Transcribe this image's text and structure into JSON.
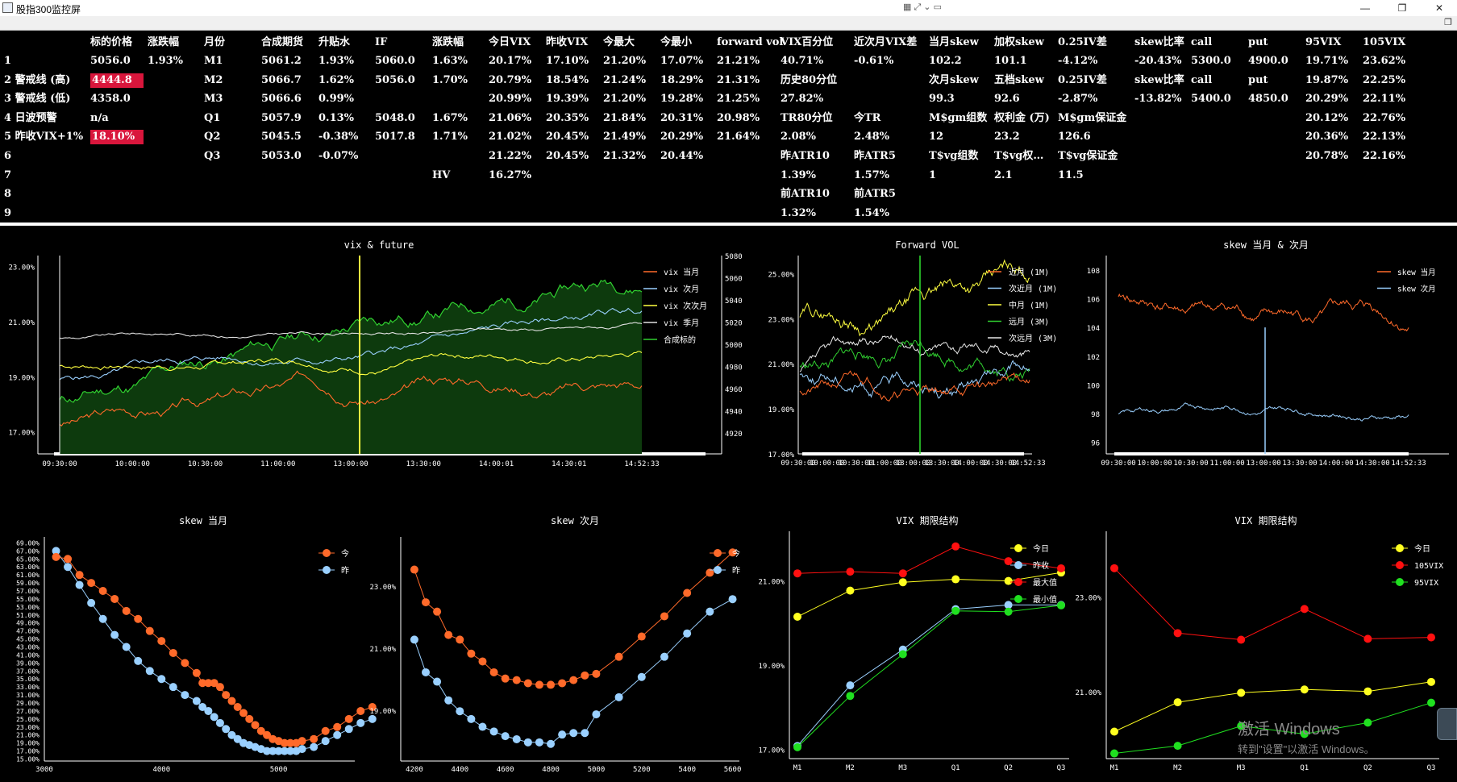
{
  "window": {
    "title": "股指300监控屏",
    "min": "—",
    "max": "❐",
    "close": "✕"
  },
  "table": {
    "headers": [
      [
        "标的价格",
        112
      ],
      [
        "涨跌幅",
        183
      ],
      [
        "月份",
        253
      ],
      [
        "合成期货",
        324
      ],
      [
        "升贴水",
        395
      ],
      [
        "IF",
        465
      ],
      [
        "涨跌幅",
        536
      ],
      [
        "今日VIX",
        606
      ],
      [
        "昨收VIX",
        677
      ],
      [
        "今最大",
        748
      ],
      [
        "今最小",
        819
      ],
      [
        "forward vol",
        889
      ],
      [
        "VIX百分位",
        968
      ],
      [
        "近次月VIX差",
        1059
      ],
      [
        "当月skew",
        1152
      ],
      [
        "加权skew",
        1233
      ],
      [
        "0.25IV差",
        1312
      ],
      [
        "skew比率",
        1407
      ],
      [
        "call",
        1477
      ],
      [
        "put",
        1548
      ],
      [
        "95VIX",
        1619
      ],
      [
        "105VIX",
        1690
      ]
    ],
    "rows": [
      [
        [
          "1",
          5
        ],
        [
          "5056.0",
          112
        ],
        [
          "1.93%",
          183
        ],
        [
          "M1",
          253
        ],
        [
          "5061.2",
          324
        ],
        [
          "1.93%",
          395
        ],
        [
          "5060.0",
          465
        ],
        [
          "1.63%",
          536
        ],
        [
          "20.17%",
          606
        ],
        [
          "17.10%",
          677
        ],
        [
          "21.20%",
          748
        ],
        [
          "17.07%",
          819
        ],
        [
          "21.21%",
          889
        ],
        [
          "40.71%",
          968
        ],
        [
          "-0.61%",
          1059
        ],
        [
          "102.2",
          1152
        ],
        [
          "101.1",
          1233
        ],
        [
          "-4.12%",
          1312
        ],
        [
          "-20.43%",
          1407
        ],
        [
          "5300.0",
          1477
        ],
        [
          "4900.0",
          1548
        ],
        [
          "19.71%",
          1619
        ],
        [
          "23.62%",
          1690
        ]
      ],
      [
        [
          "2 警戒线 (高)",
          5
        ],
        [
          "4444.8",
          112,
          "red"
        ],
        [
          "M2",
          253
        ],
        [
          "5066.7",
          324
        ],
        [
          "1.62%",
          395
        ],
        [
          "5056.0",
          465
        ],
        [
          "1.70%",
          536
        ],
        [
          "20.79%",
          606
        ],
        [
          "18.54%",
          677
        ],
        [
          "21.24%",
          748
        ],
        [
          "18.29%",
          819
        ],
        [
          "21.31%",
          889
        ],
        [
          "历史80分位",
          968
        ],
        [
          "次月skew",
          1152
        ],
        [
          "五档skew",
          1233
        ],
        [
          "0.25IV差",
          1312
        ],
        [
          "skew比率",
          1407
        ],
        [
          "call",
          1477
        ],
        [
          "put",
          1548
        ],
        [
          "19.87%",
          1619
        ],
        [
          "22.25%",
          1690
        ]
      ],
      [
        [
          "3 警戒线 (低)",
          5
        ],
        [
          "4358.0",
          112
        ],
        [
          "M3",
          253
        ],
        [
          "5066.6",
          324
        ],
        [
          "0.99%",
          395
        ],
        [
          "20.99%",
          606
        ],
        [
          "19.39%",
          677
        ],
        [
          "21.20%",
          748
        ],
        [
          "19.28%",
          819
        ],
        [
          "21.25%",
          889
        ],
        [
          "27.82%",
          968
        ],
        [
          "99.3",
          1152
        ],
        [
          "92.6",
          1233
        ],
        [
          "-2.87%",
          1312
        ],
        [
          "-13.82%",
          1407
        ],
        [
          "5400.0",
          1477
        ],
        [
          "4850.0",
          1548
        ],
        [
          "20.29%",
          1619
        ],
        [
          "22.11%",
          1690
        ]
      ],
      [
        [
          "4 日波预警",
          5
        ],
        [
          "n/a",
          112
        ],
        [
          "Q1",
          253
        ],
        [
          "5057.9",
          324
        ],
        [
          "0.13%",
          395
        ],
        [
          "5048.0",
          465
        ],
        [
          "1.67%",
          536
        ],
        [
          "21.06%",
          606
        ],
        [
          "20.35%",
          677
        ],
        [
          "21.84%",
          748
        ],
        [
          "20.31%",
          819
        ],
        [
          "20.98%",
          889
        ],
        [
          "TR80分位",
          968
        ],
        [
          "今TR",
          1059
        ],
        [
          "M$gm组数",
          1152
        ],
        [
          "权利金 (万)",
          1233
        ],
        [
          "M$gm保证金",
          1312
        ],
        [
          "20.12%",
          1619
        ],
        [
          "22.76%",
          1690
        ]
      ],
      [
        [
          "5 昨收VIX+1%",
          5
        ],
        [
          "18.10%",
          112,
          "red"
        ],
        [
          "Q2",
          253
        ],
        [
          "5045.5",
          324
        ],
        [
          "-0.38%",
          395
        ],
        [
          "5017.8",
          465
        ],
        [
          "1.71%",
          536
        ],
        [
          "21.02%",
          606
        ],
        [
          "20.45%",
          677
        ],
        [
          "21.49%",
          748
        ],
        [
          "20.29%",
          819
        ],
        [
          "21.64%",
          889
        ],
        [
          "2.08%",
          968
        ],
        [
          "2.48%",
          1059
        ],
        [
          "12",
          1152
        ],
        [
          "23.2",
          1233
        ],
        [
          "126.6",
          1312
        ],
        [
          "20.36%",
          1619
        ],
        [
          "22.13%",
          1690
        ]
      ],
      [
        [
          "6",
          5
        ],
        [
          "Q3",
          253
        ],
        [
          "5053.0",
          324
        ],
        [
          "-0.07%",
          395
        ],
        [
          "21.22%",
          606
        ],
        [
          "20.45%",
          677
        ],
        [
          "21.32%",
          748
        ],
        [
          "20.44%",
          819
        ],
        [
          "昨ATR10",
          968
        ],
        [
          "昨ATR5",
          1059
        ],
        [
          "T$vg组数",
          1152
        ],
        [
          "T$vg权…",
          1233
        ],
        [
          "T$vg保证金",
          1312
        ],
        [
          "20.78%",
          1619
        ],
        [
          "22.16%",
          1690
        ]
      ],
      [
        [
          "7",
          5
        ],
        [
          "HV",
          536
        ],
        [
          "16.27%",
          606
        ],
        [
          "1.39%",
          968
        ],
        [
          "1.57%",
          1059
        ],
        [
          "1",
          1152
        ],
        [
          "2.1",
          1233
        ],
        [
          "11.5",
          1312
        ]
      ],
      [
        [
          "8",
          5
        ],
        [
          "前ATR10",
          968
        ],
        [
          "前ATR5",
          1059
        ]
      ],
      [
        [
          "9",
          5
        ],
        [
          "1.32%",
          968
        ],
        [
          "1.54%",
          1059
        ]
      ]
    ]
  },
  "charts": {
    "vix_future": {
      "title": "vix & future",
      "yleft": [
        "23.00%",
        "21.00%",
        "19.00%",
        "17.00%"
      ],
      "yright": [
        "5080",
        "5060",
        "5040",
        "5020",
        "5000",
        "4980",
        "4960",
        "4940",
        "4920"
      ],
      "xlabels": [
        "09:30:00",
        "10:00:00",
        "10:30:00",
        "11:00:00",
        "13:00:00",
        "13:30:00",
        "14:00:01",
        "14:30:01",
        "14:52:33"
      ],
      "legend": [
        "vix 当月",
        "vix 次月",
        "vix 次次月",
        "vix 季月",
        "合成标的"
      ],
      "colors": [
        "#ff6a2a",
        "#9ad0ff",
        "#ffff40",
        "#e0e0e0",
        "#30d030"
      ]
    },
    "forward_vol": {
      "title": "Forward VOL",
      "ylabels": [
        "25.00%",
        "23.00%",
        "21.00%",
        "19.00%",
        "17.00%"
      ],
      "xlabels": [
        "09:30:00",
        "10:00:00",
        "10:30:00",
        "11:00:00",
        "13:00:00",
        "13:30:00",
        "14:00:00",
        "14:30:00",
        "14:52:33"
      ],
      "legend": [
        "近月 (1M)",
        "次近月 (1M)",
        "中月 (1M)",
        "远月 (3M)",
        "次远月 (3M)"
      ],
      "colors": [
        "#ff6a2a",
        "#9ad0ff",
        "#ffff40",
        "#30d030",
        "#e8e8e8"
      ]
    },
    "skew_both": {
      "title": "skew 当月 & 次月",
      "ylabels": [
        "108",
        "106",
        "104",
        "102",
        "100",
        "98",
        "96"
      ],
      "xlabels": [
        "09:30:00",
        "10:00:00",
        "10:30:00",
        "11:00:00",
        "13:00:00",
        "13:30:00",
        "14:00:00",
        "14:30:00",
        "14:52:33"
      ],
      "legend": [
        "skew 当月",
        "skew 次月"
      ],
      "colors": [
        "#ff6a2a",
        "#9ad0ff"
      ]
    },
    "skew_m1": {
      "title": "skew 当月",
      "legend": [
        "今",
        "昨"
      ],
      "xlabels": [
        "3000",
        "4000",
        "5000"
      ],
      "ylabels": [
        "69.00%",
        "67.00%",
        "65.00%",
        "63.00%",
        "61.00%",
        "59.00%",
        "57.00%",
        "55.00%",
        "53.00%",
        "51.00%",
        "49.00%",
        "47.00%",
        "45.00%",
        "43.00%",
        "41.00%",
        "39.00%",
        "37.00%",
        "35.00%",
        "33.00%",
        "31.00%",
        "29.00%",
        "27.00%",
        "25.00%",
        "23.00%",
        "21.00%",
        "19.00%",
        "17.00%",
        "15.00%"
      ],
      "today": [
        [
          3100,
          65.5
        ],
        [
          3200,
          65
        ],
        [
          3300,
          61
        ],
        [
          3400,
          59
        ],
        [
          3500,
          57
        ],
        [
          3600,
          55
        ],
        [
          3700,
          52
        ],
        [
          3800,
          50
        ],
        [
          3900,
          47
        ],
        [
          4000,
          44.5
        ],
        [
          4100,
          41.5
        ],
        [
          4200,
          39
        ],
        [
          4300,
          36.5
        ],
        [
          4350,
          34
        ],
        [
          4400,
          34
        ],
        [
          4450,
          34
        ],
        [
          4500,
          33
        ],
        [
          4550,
          31
        ],
        [
          4600,
          29.5
        ],
        [
          4650,
          28
        ],
        [
          4700,
          26.5
        ],
        [
          4750,
          25
        ],
        [
          4800,
          23.5
        ],
        [
          4850,
          22
        ],
        [
          4900,
          21
        ],
        [
          4950,
          20
        ],
        [
          5000,
          19.5
        ],
        [
          5050,
          19
        ],
        [
          5100,
          19
        ],
        [
          5150,
          19
        ],
        [
          5200,
          19.5
        ],
        [
          5300,
          20
        ],
        [
          5400,
          22
        ],
        [
          5500,
          23
        ],
        [
          5600,
          25
        ],
        [
          5700,
          27
        ],
        [
          5800,
          28
        ]
      ],
      "yest": [
        [
          3100,
          67
        ],
        [
          3200,
          63
        ],
        [
          3300,
          58.5
        ],
        [
          3400,
          54
        ],
        [
          3500,
          50
        ],
        [
          3600,
          46
        ],
        [
          3700,
          43
        ],
        [
          3800,
          39.5
        ],
        [
          3900,
          37
        ],
        [
          4000,
          35
        ],
        [
          4100,
          33
        ],
        [
          4200,
          31
        ],
        [
          4300,
          29.5
        ],
        [
          4350,
          28
        ],
        [
          4400,
          27
        ],
        [
          4450,
          25.5
        ],
        [
          4500,
          24
        ],
        [
          4550,
          22.5
        ],
        [
          4600,
          21
        ],
        [
          4650,
          20
        ],
        [
          4700,
          19
        ],
        [
          4750,
          18.5
        ],
        [
          4800,
          18
        ],
        [
          4850,
          17.5
        ],
        [
          4900,
          17
        ],
        [
          4950,
          17
        ],
        [
          5000,
          17
        ],
        [
          5050,
          17
        ],
        [
          5100,
          17
        ],
        [
          5150,
          17
        ],
        [
          5200,
          17.5
        ],
        [
          5300,
          18
        ],
        [
          5400,
          19.5
        ],
        [
          5500,
          21
        ],
        [
          5600,
          22.5
        ],
        [
          5700,
          24
        ],
        [
          5800,
          25
        ]
      ]
    },
    "skew_m2": {
      "title": "skew 次月",
      "legend": [
        "今",
        "昨"
      ],
      "xlabels": [
        "4200",
        "4400",
        "4600",
        "4800",
        "5000",
        "5200",
        "5400",
        "5600"
      ],
      "ylabels": [
        "23.00%",
        "21.00%",
        "19.00%"
      ],
      "today": [
        [
          4200,
          23.55
        ],
        [
          4250,
          22.5
        ],
        [
          4300,
          22.2
        ],
        [
          4350,
          21.45
        ],
        [
          4400,
          21.3
        ],
        [
          4450,
          20.85
        ],
        [
          4500,
          20.6
        ],
        [
          4550,
          20.25
        ],
        [
          4600,
          20.05
        ],
        [
          4650,
          20.0
        ],
        [
          4700,
          19.9
        ],
        [
          4750,
          19.85
        ],
        [
          4800,
          19.85
        ],
        [
          4850,
          19.9
        ],
        [
          4900,
          20.0
        ],
        [
          4950,
          20.15
        ],
        [
          5000,
          20.2
        ],
        [
          5100,
          20.75
        ],
        [
          5200,
          21.4
        ],
        [
          5300,
          22.05
        ],
        [
          5400,
          22.8
        ],
        [
          5500,
          23.45
        ],
        [
          5600,
          24.1
        ]
      ],
      "yest": [
        [
          4200,
          21.3
        ],
        [
          4250,
          20.25
        ],
        [
          4300,
          19.95
        ],
        [
          4350,
          19.35
        ],
        [
          4400,
          19.0
        ],
        [
          4450,
          18.75
        ],
        [
          4500,
          18.5
        ],
        [
          4550,
          18.35
        ],
        [
          4600,
          18.2
        ],
        [
          4650,
          18.1
        ],
        [
          4700,
          18.0
        ],
        [
          4750,
          18.0
        ],
        [
          4800,
          17.95
        ],
        [
          4850,
          18.25
        ],
        [
          4900,
          18.3
        ],
        [
          4950,
          18.3
        ],
        [
          5000,
          18.9
        ],
        [
          5100,
          19.45
        ],
        [
          5200,
          20.1
        ],
        [
          5300,
          20.75
        ],
        [
          5400,
          21.5
        ],
        [
          5500,
          22.2
        ],
        [
          5600,
          22.6
        ]
      ]
    },
    "term1": {
      "title": "VIX 期限结构",
      "legend": [
        "今日",
        "昨收",
        "最大值",
        "最小值"
      ],
      "colors": [
        "#ffff20",
        "#9ad0ff",
        "#ff1010",
        "#20e020"
      ],
      "x": [
        "M1",
        "M2",
        "M3",
        "Q1",
        "Q2",
        "Q3"
      ],
      "ylabels": [
        "21.00%",
        "19.00%",
        "17.00%"
      ],
      "series": [
        [
          20.17,
          20.79,
          20.99,
          21.06,
          21.02,
          21.22
        ],
        [
          17.1,
          18.54,
          19.39,
          20.35,
          20.45,
          20.45
        ],
        [
          21.2,
          21.24,
          21.2,
          21.84,
          21.49,
          21.32
        ],
        [
          17.07,
          18.29,
          19.28,
          20.31,
          20.29,
          20.44
        ]
      ]
    },
    "term2": {
      "title": "VIX 期限结构",
      "legend": [
        "今日",
        "105VIX",
        "95VIX"
      ],
      "colors": [
        "#ffff20",
        "#ff1010",
        "#20e020"
      ],
      "x": [
        "M1",
        "M2",
        "M3",
        "Q1",
        "Q2",
        "Q3"
      ],
      "ylabels": [
        "23.00%",
        "21.00%"
      ],
      "series": [
        [
          20.17,
          20.79,
          20.99,
          21.06,
          21.02,
          21.22
        ],
        [
          23.62,
          22.25,
          22.11,
          22.76,
          22.13,
          22.16
        ],
        [
          19.71,
          19.87,
          20.29,
          20.12,
          20.36,
          20.78
        ]
      ]
    }
  },
  "watermark": {
    "line1": "激活 Windows",
    "line2": "转到\"设置\"以激活 Windows。"
  }
}
